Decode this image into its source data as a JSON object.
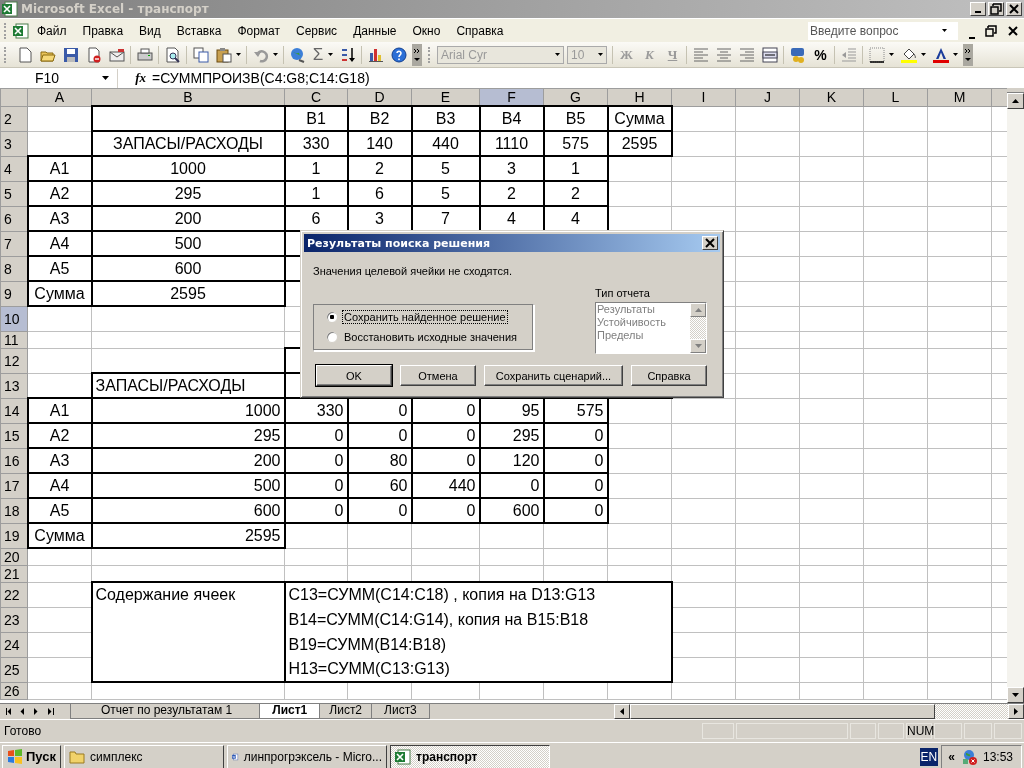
{
  "window": {
    "title": "Microsoft Excel - транспорт",
    "active": false
  },
  "menu": {
    "items": [
      "Файл",
      "Правка",
      "Вид",
      "Вставка",
      "Формат",
      "Сервис",
      "Данные",
      "Окно",
      "Справка"
    ],
    "question": {
      "placeholder": "Введите вопрос"
    }
  },
  "standard_toolbar": {
    "autosum": "Σ"
  },
  "formatting_toolbar": {
    "disabled": true,
    "font": "Arial Cyr",
    "size": "10",
    "bold": "Ж",
    "italic": "К",
    "underline": "Ч",
    "percent": "%"
  },
  "formula_bar": {
    "name_box": "F10",
    "fx": "fx",
    "formula": "=СУММПРОИЗВ(C4:G8;C14:G18)"
  },
  "sheet": {
    "columns": [
      {
        "label": "A",
        "selected": false
      },
      {
        "label": "B",
        "selected": false
      },
      {
        "label": "C",
        "selected": false
      },
      {
        "label": "D",
        "selected": false
      },
      {
        "label": "E",
        "selected": false
      },
      {
        "label": "F",
        "selected": true
      },
      {
        "label": "G",
        "selected": false
      },
      {
        "label": "H",
        "selected": false
      },
      {
        "label": "I",
        "selected": false
      },
      {
        "label": "J",
        "selected": false
      },
      {
        "label": "K",
        "selected": false
      },
      {
        "label": "L",
        "selected": false
      },
      {
        "label": "M",
        "selected": false
      }
    ],
    "rows": [
      {
        "header": "2",
        "selected": false,
        "cells": [
          null,
          null,
          "B1",
          "B2",
          "B3",
          "B4",
          "B5",
          "Сумма"
        ]
      },
      {
        "header": "3",
        "selected": false,
        "cells": [
          null,
          "ЗАПАСЫ/РАСХОДЫ",
          "330",
          "140",
          "440",
          "1110",
          "575",
          "2595"
        ]
      },
      {
        "header": "4",
        "selected": false,
        "cells": [
          "A1",
          "1000",
          "1",
          "2",
          "5",
          "3",
          "1"
        ]
      },
      {
        "header": "5",
        "selected": false,
        "cells": [
          "A2",
          "295",
          "1",
          "6",
          "5",
          "2",
          "2"
        ]
      },
      {
        "header": "6",
        "selected": false,
        "cells": [
          "A3",
          "200",
          "6",
          "3",
          "7",
          "4",
          "4"
        ]
      },
      {
        "header": "7",
        "selected": false,
        "cells": [
          "A4",
          "500"
        ]
      },
      {
        "header": "8",
        "selected": false,
        "cells": [
          "A5",
          "600"
        ]
      },
      {
        "header": "9",
        "selected": false,
        "cells": [
          "Сумма",
          "2595"
        ]
      },
      {
        "header": "10",
        "selected": true
      },
      {
        "header": "11",
        "selected": false
      },
      {
        "header": "12",
        "selected": false
      },
      {
        "header": "13",
        "selected": false,
        "cells": [
          null,
          "ЗАПАСЫ/РАСХОДЫ"
        ]
      },
      {
        "header": "14",
        "selected": false,
        "cells": [
          "A1",
          "1000",
          "330",
          "0",
          "0",
          "95",
          "575"
        ]
      },
      {
        "header": "15",
        "selected": false,
        "cells": [
          "A2",
          "295",
          "0",
          "0",
          "0",
          "295",
          "0"
        ]
      },
      {
        "header": "16",
        "selected": false,
        "cells": [
          "A3",
          "200",
          "0",
          "80",
          "0",
          "120",
          "0"
        ]
      },
      {
        "header": "17",
        "selected": false,
        "cells": [
          "A4",
          "500",
          "0",
          "60",
          "440",
          "0",
          "0"
        ]
      },
      {
        "header": "18",
        "selected": false,
        "cells": [
          "A5",
          "600",
          "0",
          "0",
          "0",
          "600",
          "0"
        ]
      },
      {
        "header": "19",
        "selected": false,
        "cells": [
          "Сумма",
          "2595"
        ]
      },
      {
        "header": "20",
        "selected": false
      },
      {
        "header": "21",
        "selected": false
      },
      {
        "header": "22",
        "selected": false,
        "cells": [
          null,
          "Содержание ячеек",
          "C13=СУММ(C14:C18) , копия на D13:G13"
        ]
      },
      {
        "header": "23",
        "selected": false,
        "cells": [
          null,
          null,
          "B14=СУММ(C14:G14), копия на B15:B18"
        ]
      },
      {
        "header": "24",
        "selected": false,
        "cells": [
          null,
          null,
          "B19=СУММ(B14:B18)"
        ]
      },
      {
        "header": "25",
        "selected": false,
        "cells": [
          null,
          null,
          "H13=СУММ(C13:G13)"
        ]
      },
      {
        "header": "26",
        "selected": false
      }
    ]
  },
  "dialog": {
    "title": "Результаты поиска решения",
    "message": "Значения целевой ячейки не сходятся.",
    "options": [
      {
        "label": "Сохранить найденное решение",
        "selected": true
      },
      {
        "label": "Восстановить исходные значения",
        "selected": false
      }
    ],
    "report_type": {
      "label": "Тип отчета",
      "disabled": true,
      "items": [
        "Результаты",
        "Устойчивость",
        "Пределы"
      ]
    },
    "buttons": [
      {
        "label": "OK",
        "default": true
      },
      {
        "label": "Отмена",
        "default": false
      },
      {
        "label": "Сохранить сценарий...",
        "default": false
      },
      {
        "label": "Справка",
        "default": false
      }
    ]
  },
  "sheet_tabs": [
    {
      "label": "Отчет по результатам 1",
      "selected": false
    },
    {
      "label": "Лист1",
      "selected": true
    },
    {
      "label": "Лист2",
      "selected": false
    },
    {
      "label": "Лист3",
      "selected": false
    }
  ],
  "status_bar": {
    "text": "Готово",
    "indicators": [
      "NUM"
    ]
  },
  "taskbar": {
    "start": "Пуск",
    "tasks": [
      {
        "label": "симплекс",
        "kind": "folder",
        "selected": false
      },
      {
        "label": "линпрогрэксель - Micro...",
        "kind": "word",
        "selected": false
      },
      {
        "label": "транспорт",
        "kind": "excel",
        "selected": true
      }
    ],
    "language": "EN",
    "tray_toggle": "«",
    "clock": "13:53"
  }
}
